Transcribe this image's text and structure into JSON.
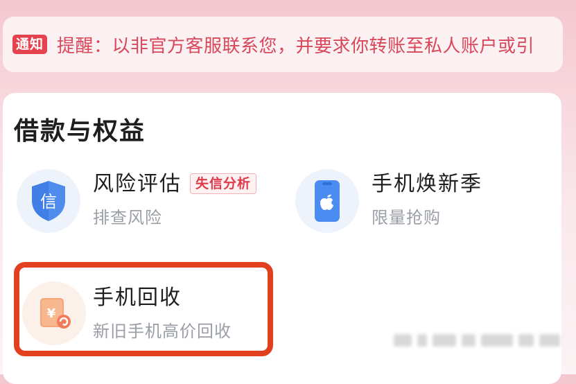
{
  "notice": {
    "tag": "通知",
    "text": "提醒：以非官方客服联系您，并要求你转账至私人账户或引"
  },
  "section": {
    "title": "借款与权益"
  },
  "items": [
    {
      "title": "风险评估",
      "subtitle": "排查风险",
      "badge": "失信分析",
      "icon": "shield-icon",
      "icon_text": "信"
    },
    {
      "title": "手机焕新季",
      "subtitle": "限量抢购",
      "icon": "phone-apple-icon"
    },
    {
      "title": "手机回收",
      "subtitle": "新旧手机高价回收",
      "icon": "phone-recycle-icon",
      "icon_text": "¥"
    }
  ],
  "colors": {
    "accent_red": "#e5424e",
    "notice_text": "#d8485a",
    "highlight_border": "#e23f1e",
    "shield_blue": "#3f7fe6"
  }
}
